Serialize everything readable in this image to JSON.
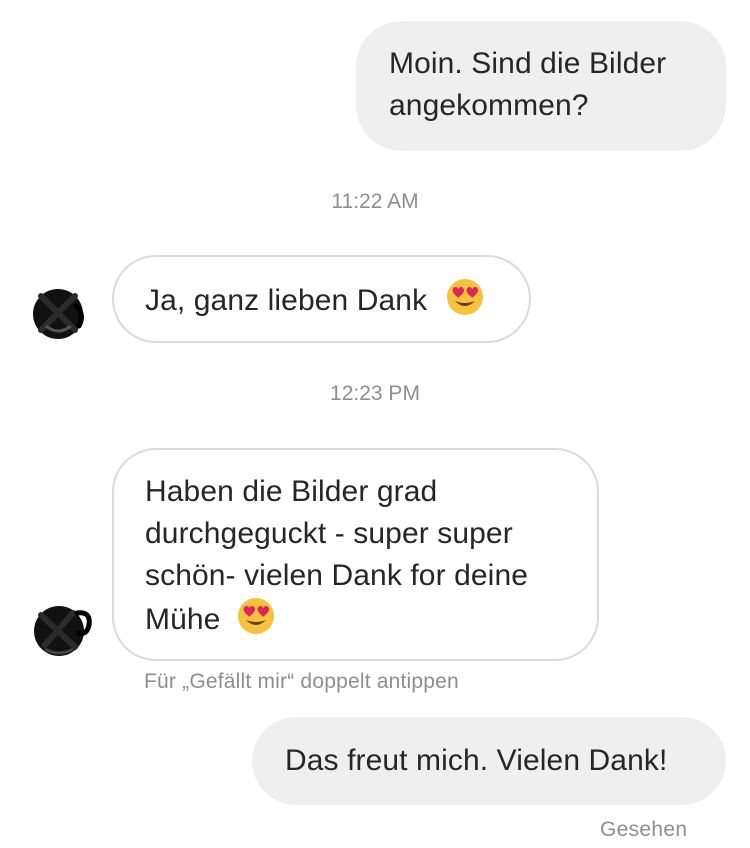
{
  "messages": [
    {
      "direction": "outgoing",
      "lines": [
        "Moin. Sind die Bilder",
        "angekommen?"
      ]
    },
    {
      "timestamp": "11:22 AM"
    },
    {
      "direction": "incoming",
      "text": "Ja, ganz lieben Dank",
      "emoji": "smiling-face-with-heart-eyes"
    },
    {
      "timestamp": "12:23 PM"
    },
    {
      "direction": "incoming",
      "lines": [
        "Haben die Bilder grad",
        "durchgeguckt - super super",
        "schön- vielen Dank for deine",
        "Mühe"
      ],
      "emoji": "smiling-face-with-heart-eyes",
      "hint": "Für „Gefällt mir“ doppelt antippen"
    },
    {
      "direction": "outgoing",
      "text": "Das freut mich. Vielen Dank!",
      "status": "Gesehen"
    }
  ],
  "colors": {
    "outgoing_bubble": "#efefef",
    "incoming_border": "#dbdbdb",
    "meta_text": "#8e8e8e",
    "message_text": "#262626"
  }
}
